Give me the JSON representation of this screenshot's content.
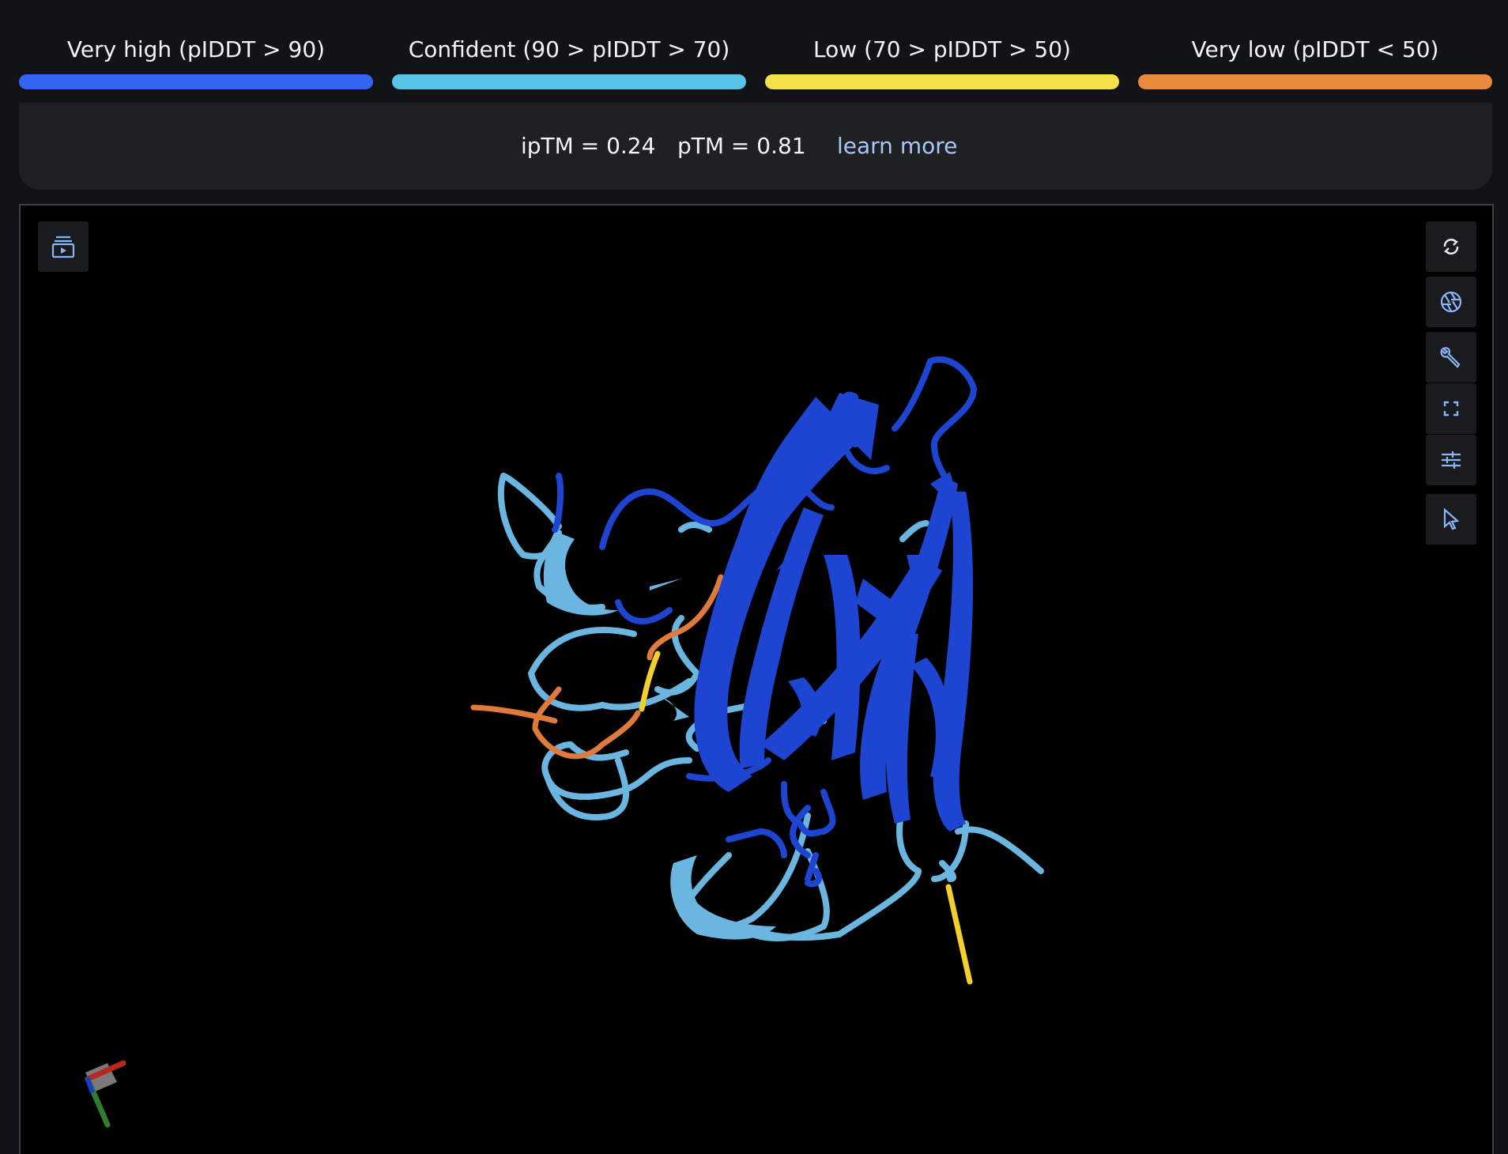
{
  "legend": [
    {
      "label": "Very high (pIDDT > 90)",
      "color": "#3366f0"
    },
    {
      "label": "Confident (90 > pIDDT > 70)",
      "color": "#57c4ea"
    },
    {
      "label": "Low (70 > pIDDT > 50)",
      "color": "#f8e04a"
    },
    {
      "label": "Very low (pIDDT < 50)",
      "color": "#e98a3b"
    }
  ],
  "metrics": {
    "iptm": "ipTM = 0.24",
    "ptm": "pTM = 0.81",
    "learn_more": "learn more"
  },
  "toolbar": {
    "left": {
      "icon": "sequence-play-icon"
    },
    "right": [
      {
        "icon": "rotate-icon"
      },
      {
        "icon": "camera-aperture-icon"
      },
      {
        "icon": "wrench-icon"
      },
      {
        "icon": "fullscreen-icon"
      },
      {
        "icon": "sliders-icon"
      },
      {
        "icon": "pointer-icon"
      }
    ]
  },
  "structure": {
    "colors": {
      "very_high": "#1d45d2",
      "confident": "#6bb6e0",
      "low": "#f3cf2c",
      "very_low": "#e07a3c"
    }
  }
}
